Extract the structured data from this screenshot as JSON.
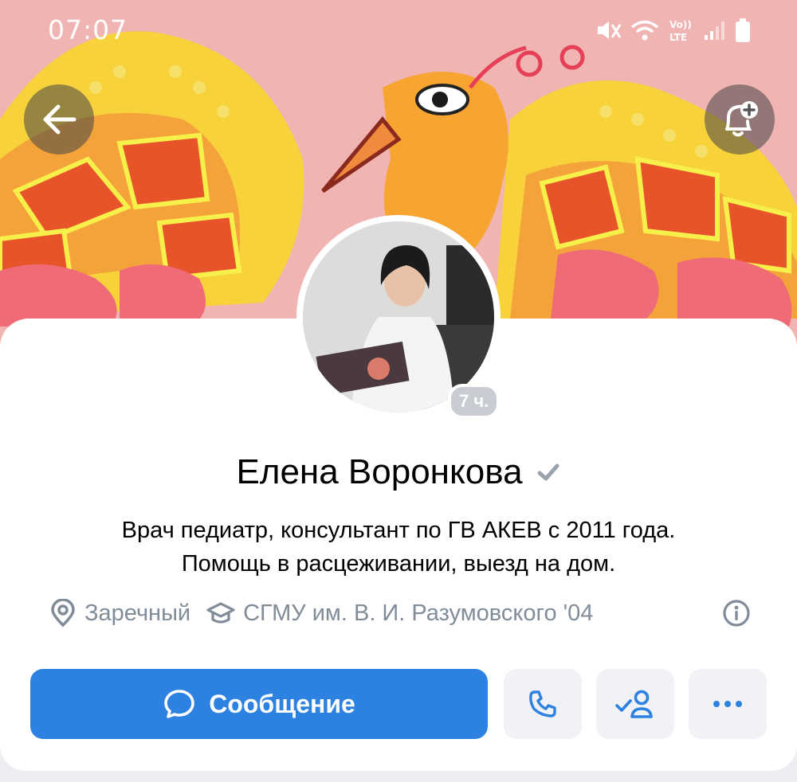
{
  "status_bar": {
    "time": "07:07",
    "network_label": "Vo))\nLTE"
  },
  "profile": {
    "name": "Елена Воронкова",
    "status_line1": "Врач педиатр, консультант по ГВ АКЕВ с 2011 года.",
    "status_line2": "Помощь в расцеживании, выезд на дом.",
    "online_label": "7 ч.",
    "city": "Заречный",
    "education": "СГМУ им. В. И. Разумовского '04"
  },
  "actions": {
    "message_label": "Сообщение"
  },
  "icons": {
    "back": "arrow-left-icon",
    "notify": "bell-plus-icon",
    "verified": "check-icon",
    "location": "map-pin-icon",
    "education": "graduation-cap-icon",
    "info": "info-icon",
    "message": "chat-bubble-icon",
    "call": "phone-icon",
    "friend": "user-check-icon",
    "more": "more-horizontal-icon"
  },
  "colors": {
    "accent": "#2d81e0",
    "secondary_text": "#818c99",
    "button_bg": "#f0f2f5"
  }
}
